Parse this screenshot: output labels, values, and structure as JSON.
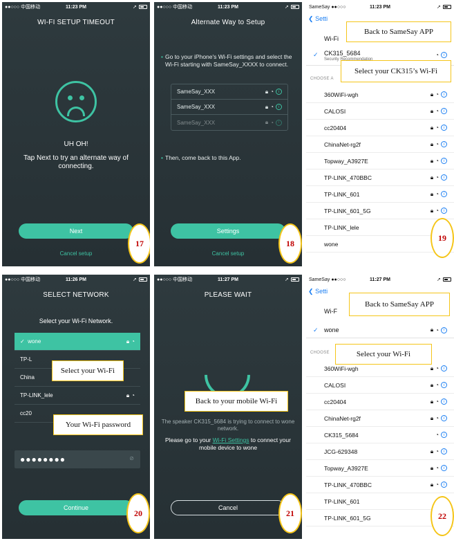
{
  "status": {
    "carrier": "●●○○○ 中国移动",
    "carrier_short": "●●○○○",
    "back_app": "SameSay",
    "times": [
      "11:23 PM",
      "11:23 PM",
      "11:23 PM",
      "11:26 PM",
      "11:27 PM",
      "11:27 PM"
    ]
  },
  "p17": {
    "title": "WI-FI SETUP TIMEOUT",
    "heading": "UH OH!",
    "message": "Tap Next to try an alternate way of connecting.",
    "next_label": "Next",
    "cancel_label": "Cancel setup",
    "step": "17"
  },
  "p18": {
    "title": "Alternate Way to Setup",
    "instruction": "Go to your iPhone's Wi-Fi settings and select the Wi-Fi starting with SameSay_XXXX to connect.",
    "networks": [
      "SameSay_XXX",
      "SameSay_XXX",
      "SameSay_XXX"
    ],
    "then": "Then, come back to this App.",
    "settings_label": "Settings",
    "cancel_label": "Cancel setup",
    "step": "18"
  },
  "p19": {
    "back_label": "Setti",
    "wifi_label": "Wi-Fi",
    "selected_name": "CK315_5684",
    "selected_sub": "Security Recommendation",
    "choose_label": "CHOOSE A",
    "networks": [
      "360WiFi-wgh",
      "CALOSI",
      "cc20404",
      "ChinaNet-rg2f",
      "Topway_A3927E",
      "TP-LINK_470BBC",
      "TP-LINK_601",
      "TP-LINK_601_5G",
      "TP-LINK_lele",
      "wone"
    ],
    "callout_back": "Back to SameSay APP",
    "callout_select": "Select your CK315’s Wi-Fi",
    "step": "19"
  },
  "p20": {
    "title": "SELECT NETWORK",
    "prompt": "Select your Wi-Fi Network.",
    "networks": [
      "wone",
      "TP-L",
      "China",
      "TP-LINK_lele",
      "cc20"
    ],
    "password_mask": "●●●●●●●●",
    "continue_label": "Continue",
    "callout_select": "Select your Wi-Fi",
    "callout_password": "Your Wi-Fi password",
    "step": "20"
  },
  "p21": {
    "title": "PLEASE WAIT",
    "line1": "The speaker CK315_5684 is trying to connect to wone network.",
    "line2_pre": "Please go to your ",
    "line2_link": "Wi-Fi Settings",
    "line2_post": " to connect your mobile device to wone",
    "cancel_label": "Cancel",
    "callout_back": "Back to your mobile Wi-Fi",
    "step": "21"
  },
  "p22": {
    "back_label": "Setti",
    "wifi_label": "Wi-F",
    "selected_name": "wone",
    "choose_label": "CHOOSE",
    "networks": [
      "360WiFi-wgh",
      "CALOSI",
      "cc20404",
      "ChinaNet-rg2f",
      "CK315_5684",
      "JCG-629348",
      "Topway_A3927E",
      "TP-LINK_470BBC",
      "TP-LINK_601",
      "TP-LINK_601_5G"
    ],
    "locked": [
      true,
      true,
      true,
      true,
      false,
      true,
      true,
      true,
      true,
      true
    ],
    "callout_back": "Back to SameSay APP",
    "callout_select": "Select your Wi-Fi",
    "step": "22"
  }
}
